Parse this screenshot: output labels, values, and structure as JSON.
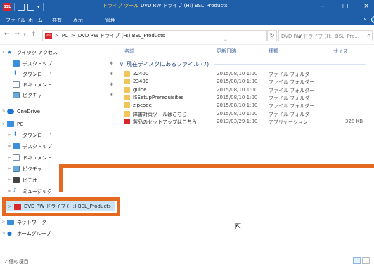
{
  "window": {
    "app_icon_text": "BSL",
    "context_tab": "ドライブ ツール",
    "title": "DVD RW ドライブ (H:) BSL_Products",
    "minimize": "–",
    "maximize": "□",
    "close": "×"
  },
  "ribbon": {
    "tabs": [
      "ファイル",
      "ホーム",
      "共有",
      "表示",
      "管理"
    ],
    "expand": "∨",
    "help": "?"
  },
  "address": {
    "back": "←",
    "forward": "→",
    "recent": "∨",
    "up": "↑",
    "path": [
      "PC",
      "DVD RW ドライブ (H:) BSL_Products"
    ],
    "sep": ">",
    "dropdown": "∨",
    "refresh": "↻",
    "search_placeholder": "DVD RW ドライブ (H:) BSL_Pro...",
    "search_icon": "search-icon"
  },
  "nav": {
    "quick_access": "クイック アクセス",
    "quick_items": [
      "デスクトップ",
      "ダウンロード",
      "ドキュメント",
      "ピクチャ"
    ],
    "pin": "✱",
    "onedrive": "OneDrive",
    "pc": "PC",
    "pc_items": [
      "ダウンロード",
      "デスクトップ",
      "ドキュメント",
      "ピクチャ",
      "ビデオ",
      "ミュージック"
    ],
    "dvd": "DVD RW ドライブ (H:) BSL_Products",
    "network": "ネットワーク",
    "homegroup": "ホームグループ"
  },
  "columns": {
    "name": "名前",
    "date": "更新日時",
    "type": "種類",
    "size": "サイズ",
    "sort_indicator": "^"
  },
  "group": {
    "chevron": "∨",
    "label": "現在ディスクにあるファイル (7)"
  },
  "files": [
    {
      "name": "22400",
      "date": "2015/08/10 1:00",
      "type": "ファイル フォルダー",
      "size": "",
      "kind": "folder"
    },
    {
      "name": "23400",
      "date": "2015/08/10 1:00",
      "type": "ファイル フォルダー",
      "size": "",
      "kind": "folder"
    },
    {
      "name": "guide",
      "date": "2015/08/10 1:00",
      "type": "ファイル フォルダー",
      "size": "",
      "kind": "folder"
    },
    {
      "name": "ISSetupPrerequisites",
      "date": "2015/08/10 1:00",
      "type": "ファイル フォルダー",
      "size": "",
      "kind": "folder"
    },
    {
      "name": "zipcode",
      "date": "2015/08/10 1:00",
      "type": "ファイル フォルダー",
      "size": "",
      "kind": "folder"
    },
    {
      "name": "障害対策ツールはこちら",
      "date": "2015/08/10 1:00",
      "type": "ファイル フォルダー",
      "size": "",
      "kind": "folder"
    },
    {
      "name": "製品のセットアップはこちら",
      "date": "2013/03/29 1:00",
      "type": "アプリケーション",
      "size": "328 KB",
      "kind": "app"
    }
  ],
  "status": {
    "count": "7 個の項目"
  },
  "colors": {
    "titlebar": "#1f5ea8",
    "highlight": "#e46a22",
    "selection": "#cce4f7"
  }
}
